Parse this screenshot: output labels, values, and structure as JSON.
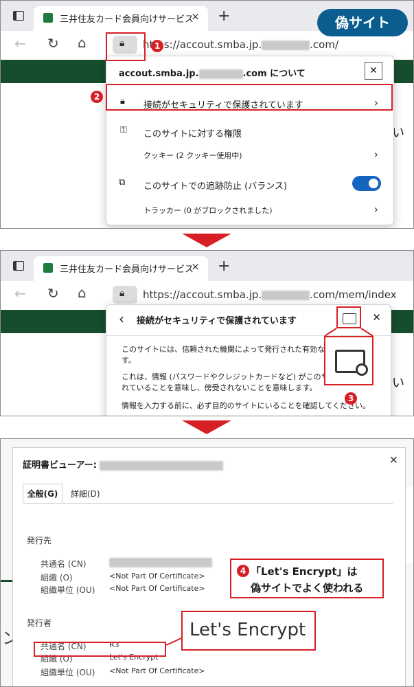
{
  "fake_site_badge": "偽サイト",
  "colors": {
    "accent_red": "#d81f26",
    "brand_green": "#164d2c",
    "badge_blue": "#0c5d8f",
    "toggle_blue": "#1565c0"
  },
  "browser": {
    "tab_title": "三井住友カード会員向けサービス",
    "tab_close": "×",
    "new_tab": "+",
    "url_panel1_prefix": "https://accout.smba.jp.",
    "url_panel1_suffix": ".com/",
    "url_panel2_prefix": "https://accout.smba.jp.",
    "url_panel2_suffix": ".com/mem/index"
  },
  "site_popup": {
    "title_prefix": "accout.smba.jp.",
    "title_suffix": ".com について",
    "close": "✕",
    "secure_connection": "接続がセキュリティで保護されています",
    "permissions": "このサイトに対する権限",
    "cookies": "クッキー (2 クッキー使用中)",
    "tracking": "このサイトでの追跡防止 (バランス)",
    "trackers": "トラッカー (0 がブロックされました)"
  },
  "security_popup": {
    "back": "‹",
    "title": "接続がセキュリティで保護されています",
    "close": "✕",
    "para1_line1": "このサイトには、信頼された機関によって発行された有効な証",
    "para1_line2": "す。",
    "para2_line1": "これは、情報 (パスワードやクレジットカードなど) がこのサイトに",
    "para2_line2": "れていることを意味し、傍受されないことを意味します。",
    "para3": "情報を入力する前に、必ず目的のサイトにいることを確認してください。"
  },
  "page_fragments": {
    "glyph_1": "い",
    "glyph_2": "い",
    "glyph_3": "ン"
  },
  "certificate_viewer": {
    "title": "証明書ビューアー:",
    "close": "✕",
    "tabs": [
      "全般(G)",
      "詳細(D)"
    ],
    "issued_to_heading": "発行先",
    "issued_to": [
      {
        "label": "共通名 (CN)",
        "value": ""
      },
      {
        "label": "組織 (O)",
        "value": "<Not Part Of Certificate>"
      },
      {
        "label": "組織単位 (OU)",
        "value": "<Not Part Of Certificate>"
      }
    ],
    "issuer_heading": "発行者",
    "issuer": [
      {
        "label": "共通名 (CN)",
        "value": "R3"
      },
      {
        "label": "組織 (O)",
        "value": "Let's Encrypt"
      },
      {
        "label": "組織単位 (OU)",
        "value": "<Not Part Of Certificate>"
      }
    ],
    "zoom_label": "Let's Encrypt"
  },
  "annotations": {
    "badge_1": "1",
    "badge_2": "2",
    "badge_3": "3",
    "badge_4": "4",
    "note_line1": "「Let's Encrypt」は",
    "note_line2": "偽サイトでよく使われる"
  }
}
